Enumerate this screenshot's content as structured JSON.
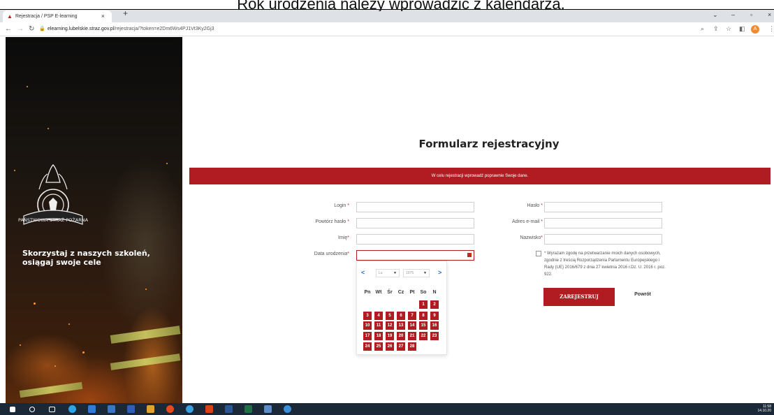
{
  "caption": "Rok urodzenia należy wprowadzić z kalendarza.",
  "browser": {
    "tab_title": "Rejestracja / PSP E-learning",
    "tab_close": "×",
    "new_tab": "+",
    "url_host": "elearning.lubelskie.straz.gov.pl",
    "url_path": "/rejestracja/?token=e2Dm6Ws4PJ1Vt3Ky2Gj3",
    "window_controls": [
      "chevron-down-icon",
      "minimize-icon",
      "restore-icon",
      "close-icon"
    ],
    "nav_icons": [
      "back-arrow-icon",
      "forward-arrow-icon",
      "reload-icon"
    ],
    "right_icons": [
      "zoom-icon",
      "share-icon",
      "star-icon",
      "sidepanel-icon",
      "profile-icon",
      "menu-icon"
    ]
  },
  "hero": {
    "tagline": "Skorzystaj z naszych szkoleń, osiągaj swoje cele",
    "logo_name": "psp-emblem"
  },
  "form": {
    "title": "Formularz rejestracyjny",
    "banner": "W celu rejestracji wprowadź poprawnie Swoje dane.",
    "fields_left": [
      {
        "label": "Login",
        "required": " *",
        "value": ""
      },
      {
        "label": "Powtórz hasło",
        "required": " *",
        "value": ""
      },
      {
        "label": "Imię",
        "required": "*",
        "value": ""
      },
      {
        "label": "Data urodzenia",
        "required": "*",
        "value": ""
      }
    ],
    "fields_right": [
      {
        "label": "Hasło",
        "required": " *",
        "value": ""
      },
      {
        "label": "Adres e-mail",
        "required": " *",
        "value": ""
      },
      {
        "label": "Nazwisko",
        "required": "*",
        "value": ""
      }
    ],
    "consent": "* Wyrażam zgodę na przetwarzanie moich danych osobowych, zgodnie z treścią Rozporządzenia Parlamentu Europejskiego i Rady (UE) 2016/679 z dnia 27 kwietnia 2016 r.Dz. U. 2016 r. poz. 922.",
    "register_button": "ZAREJESTRUJ",
    "back_link": "Powrót"
  },
  "datepicker": {
    "prev": "<",
    "next": ">",
    "month": "Lu",
    "year": "1975",
    "weekdays": [
      "Pn",
      "Wt",
      "Śr",
      "Cz",
      "Pt",
      "So",
      "N"
    ],
    "weeks": [
      [
        "",
        "",
        "",
        "",
        "",
        "1",
        "2"
      ],
      [
        "3",
        "4",
        "5",
        "6",
        "7",
        "8",
        "9"
      ],
      [
        "10",
        "11",
        "12",
        "13",
        "14",
        "15",
        "16"
      ],
      [
        "17",
        "18",
        "19",
        "20",
        "21",
        "22",
        "23"
      ],
      [
        "24",
        "25",
        "26",
        "27",
        "28",
        "",
        ""
      ]
    ]
  },
  "taskbar": {
    "time": "11:58",
    "date": "14.10.20"
  },
  "colors": {
    "accent": "#b01c21",
    "link": "#2a6fc9"
  }
}
